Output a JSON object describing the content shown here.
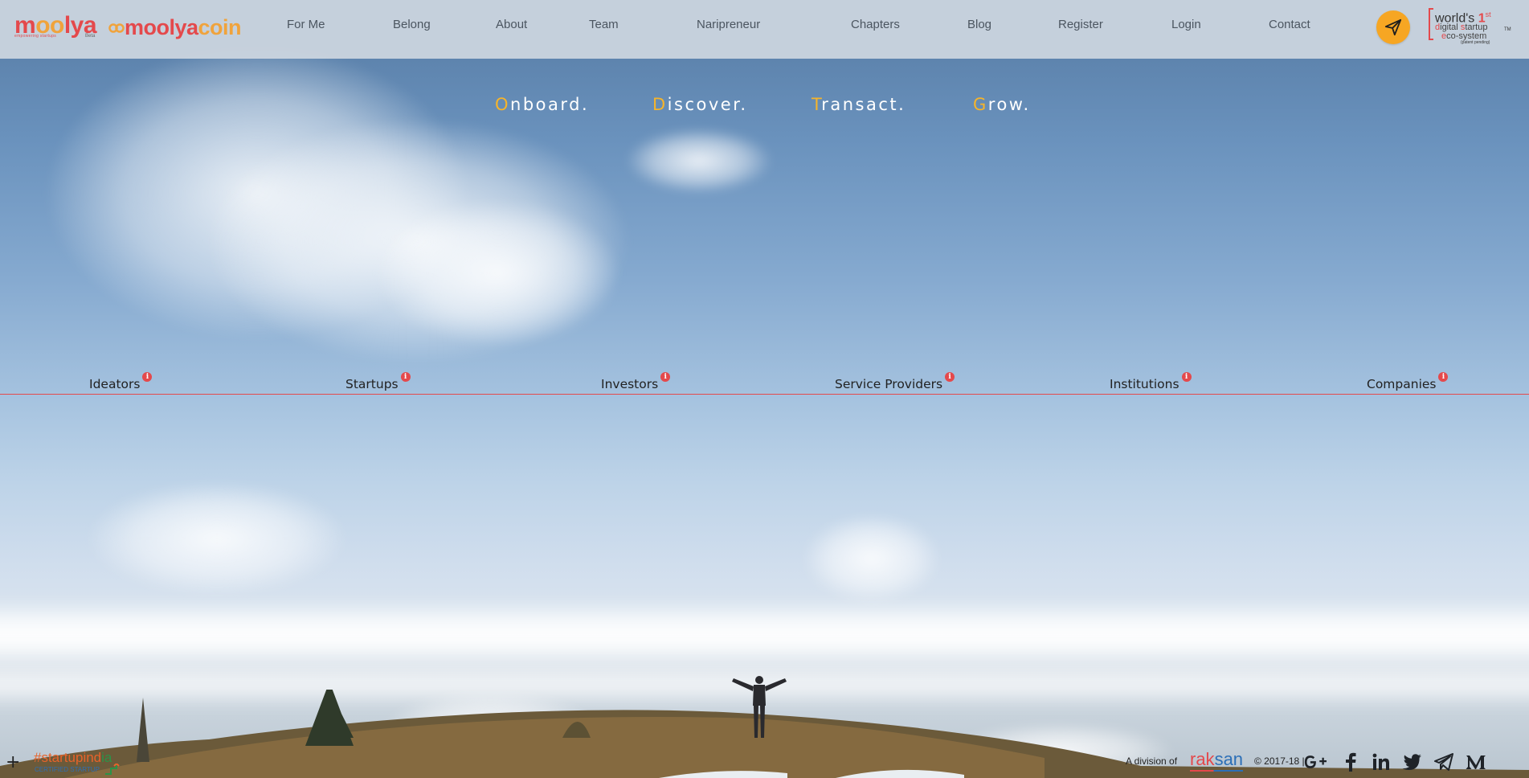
{
  "header": {
    "brand": {
      "moolya_pre": "m",
      "moolya_oo": "oo",
      "moolya_post": "lya",
      "moolya_tagline": "empowering startups",
      "moolya_beta": "Beta",
      "coin_a": "moolya",
      "coin_b": "coin"
    },
    "nav": [
      {
        "label": "For Me"
      },
      {
        "label": "Belong"
      },
      {
        "label": "About"
      },
      {
        "label": "Team"
      },
      {
        "label": "Naripreneur"
      },
      {
        "label": "Chapters"
      },
      {
        "label": "Blog"
      },
      {
        "label": "Register"
      },
      {
        "label": "Login"
      },
      {
        "label": "Contact"
      }
    ],
    "send_icon": "paper-plane-icon",
    "tagline": {
      "line1_pre": "world's ",
      "line1_num": "1",
      "line1_sup": "st",
      "line2_d": "d",
      "line2_rest": "igital ",
      "line2_s": "s",
      "line2_rest2": "tartup",
      "line3_e": "e",
      "line3_rest": "co-system",
      "tm": "TM",
      "line4": "(patent pending)"
    }
  },
  "motto": [
    {
      "first": "O",
      "rest": "nboard."
    },
    {
      "first": "D",
      "rest": "iscover."
    },
    {
      "first": "T",
      "rest": "ransact."
    },
    {
      "first": "G",
      "rest": "row."
    }
  ],
  "categories": [
    {
      "label": "Ideators",
      "info": "i"
    },
    {
      "label": "Startups",
      "info": "i"
    },
    {
      "label": "Investors",
      "info": "i"
    },
    {
      "label": "Service Providers",
      "info": "i"
    },
    {
      "label": "Institutions",
      "info": "i"
    },
    {
      "label": "Companies",
      "info": "i"
    }
  ],
  "footer": {
    "plus": "+",
    "startup_hash": "#startup",
    "startup_ind": "ind",
    "startup_ia": "ia",
    "startup_cert": "CERTIFIED STARTUP",
    "division": "A division of",
    "raksan_a": "rak",
    "raksan_b": "san",
    "copyright": "© 2017-18  |",
    "social": [
      "google-plus-icon",
      "facebook-icon",
      "linkedin-icon",
      "twitter-icon",
      "telegram-icon",
      "medium-icon"
    ]
  },
  "colors": {
    "brand_red": "#e4494c",
    "brand_orange": "#f0a33c",
    "accent_yellow": "#f6a623",
    "raksan_blue": "#2c6fb7"
  }
}
